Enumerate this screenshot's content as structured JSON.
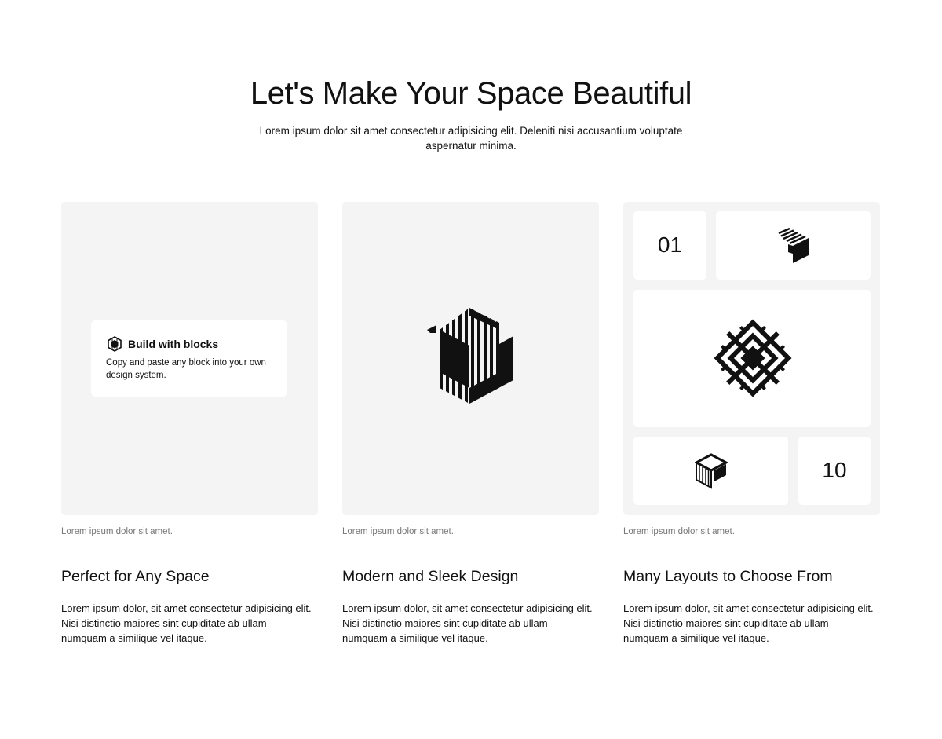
{
  "hero": {
    "title": "Let's Make Your Space Beautiful",
    "subtitle": "Lorem ipsum dolor sit amet consectetur adipisicing elit. Deleniti nisi accusantium voluptate aspernatur minima."
  },
  "cards": [
    {
      "caption": "Lorem ipsum dolor sit amet.",
      "title": "Perfect for Any Space",
      "body": "Lorem ipsum dolor, sit amet consectetur adipisicing elit. Nisi distinctio maiores sint cupiditate ab ullam numquam a similique vel itaque.",
      "mini_card": {
        "icon": "block-logo-icon",
        "title": "Build with blocks",
        "description": "Copy and paste any block into your own design system."
      }
    },
    {
      "caption": "Lorem ipsum dolor sit amet.",
      "title": "Modern and Sleek Design",
      "body": "Lorem ipsum dolor, sit amet consectetur adipisicing elit. Nisi distinctio maiores sint cupiditate ab ullam numquam a similique vel itaque.",
      "logo": "striped-hexagon-logo-icon"
    },
    {
      "caption": "Lorem ipsum dolor sit amet.",
      "title": "Many Layouts to Choose From",
      "body": "Lorem ipsum dolor, sit amet consectetur adipisicing elit. Nisi distinctio maiores sint cupiditate ab ullam numquam a similique vel itaque.",
      "tiles": {
        "first_number": "01",
        "last_number": "10",
        "icons": [
          "striped-cube-logo-icon",
          "diamond-comb-logo-icon",
          "cube-outline-logo-icon"
        ]
      }
    }
  ],
  "colors": {
    "card_background": "#f4f4f4",
    "tile_background": "#ffffff",
    "text": "#111111",
    "caption": "#777777"
  }
}
